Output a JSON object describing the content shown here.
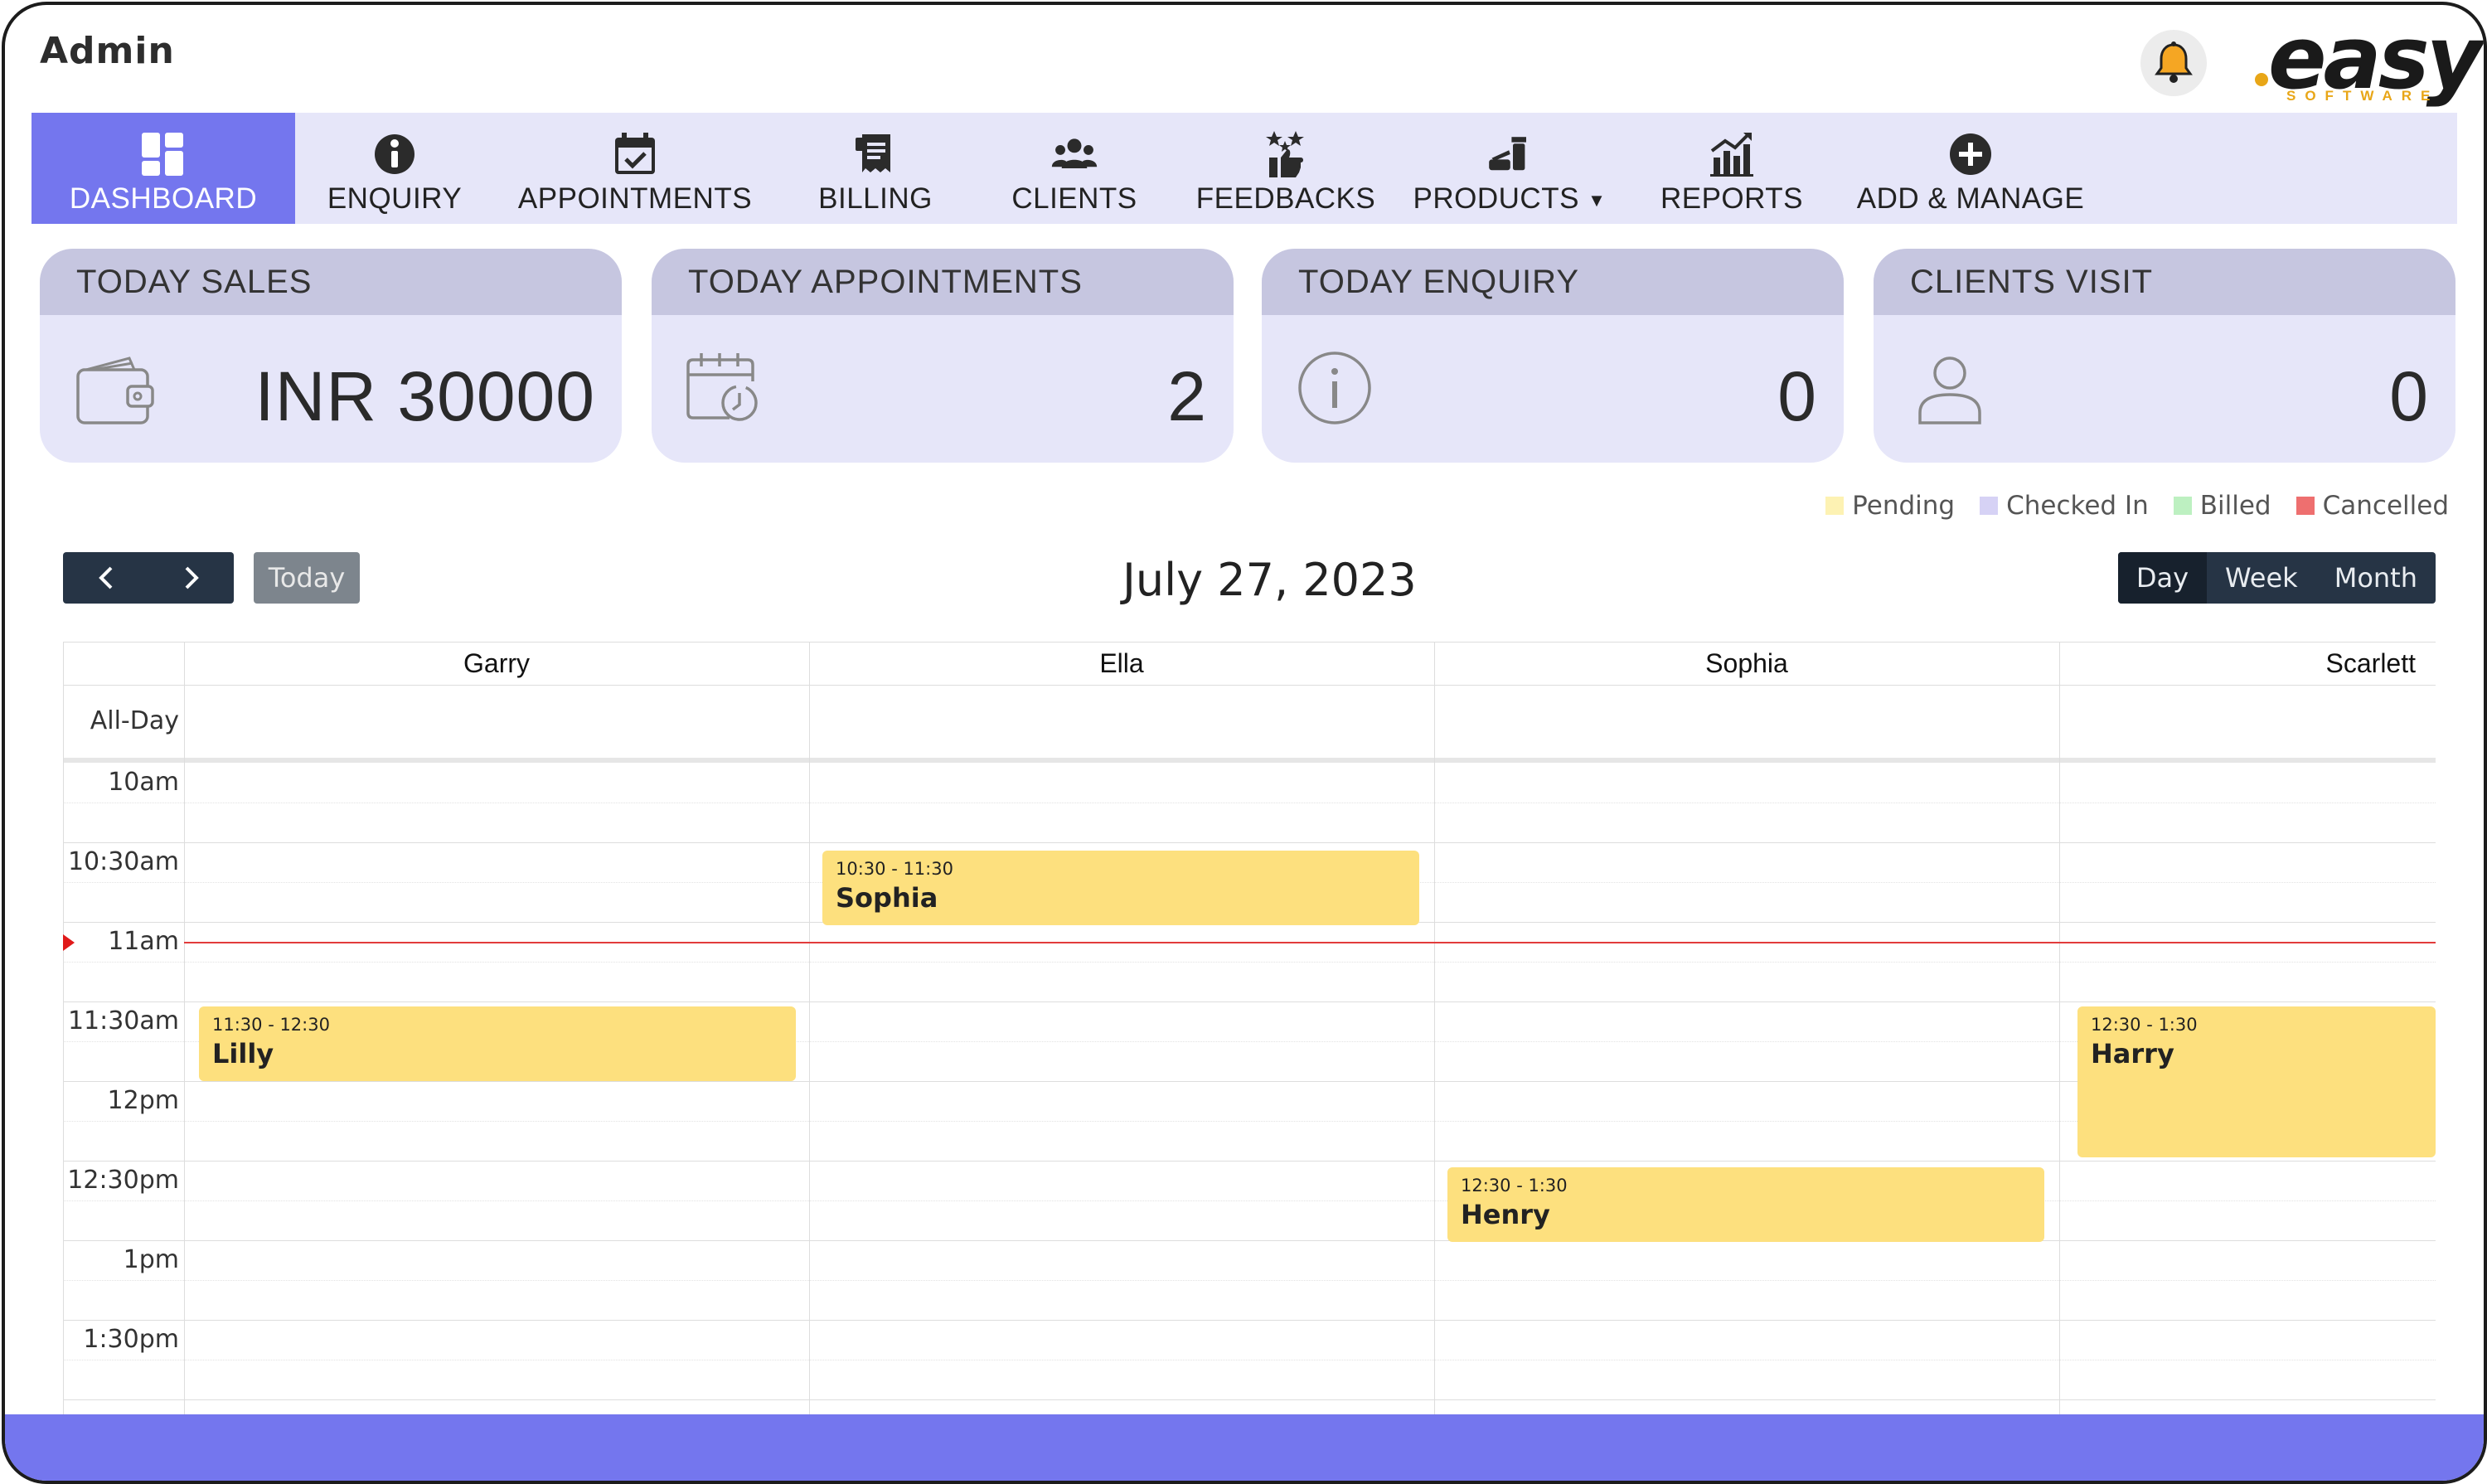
{
  "header": {
    "title": "Admin"
  },
  "brand": {
    "logo_text": "easy",
    "logo_sub": "SOFTWARE",
    "accent": "#e8a617"
  },
  "nav": {
    "items": [
      {
        "label": "DASHBOARD",
        "icon": "dashboard-icon"
      },
      {
        "label": "ENQUIRY",
        "icon": "info-icon"
      },
      {
        "label": "APPOINTMENTS",
        "icon": "calendar-check-icon"
      },
      {
        "label": "BILLING",
        "icon": "receipt-icon"
      },
      {
        "label": "CLIENTS",
        "icon": "users-icon"
      },
      {
        "label": "FEEDBACKS",
        "icon": "feedback-icon"
      },
      {
        "label": "PRODUCTS",
        "icon": "products-icon"
      },
      {
        "label": "REPORTS",
        "icon": "chart-icon"
      },
      {
        "label": "ADD & MANAGE",
        "icon": "plus-circle-icon"
      }
    ]
  },
  "cards": [
    {
      "title": "TODAY SALES",
      "value": "INR 30000",
      "icon": "wallet-icon"
    },
    {
      "title": "TODAY APPOINTMENTS",
      "value": "2",
      "icon": "calendar-clock-icon"
    },
    {
      "title": "TODAY ENQUIRY",
      "value": "0",
      "icon": "info-circle-icon"
    },
    {
      "title": "CLIENTS VISIT",
      "value": "0",
      "icon": "user-icon"
    }
  ],
  "legend": [
    {
      "label": "Pending",
      "color": "#fdf2b3"
    },
    {
      "label": "Checked In",
      "color": "#d6d2f5"
    },
    {
      "label": "Billed",
      "color": "#bdf0c1"
    },
    {
      "label": "Cancelled",
      "color": "#ee6f6f"
    }
  ],
  "calendar": {
    "date": "July 27, 2023",
    "today_label": "Today",
    "views": [
      "Day",
      "Week",
      "Month"
    ],
    "active_view": "Day",
    "staff": [
      "Garry",
      "Ella",
      "Sophia",
      "Scarlett"
    ],
    "all_day_label": "All-Day",
    "times": [
      "10am",
      "10:30am",
      "11am",
      "11:30am",
      "12pm",
      "12:30pm",
      "1pm",
      "1:30pm"
    ],
    "events": [
      {
        "time": "10:30 - 11:30",
        "client": "Sophia"
      },
      {
        "time": "11:30 - 12:30",
        "client": "Lilly"
      },
      {
        "time": "12:30 - 1:30",
        "client": "Harry"
      },
      {
        "time": "12:30 - 1:30",
        "client": "Henry"
      }
    ]
  }
}
